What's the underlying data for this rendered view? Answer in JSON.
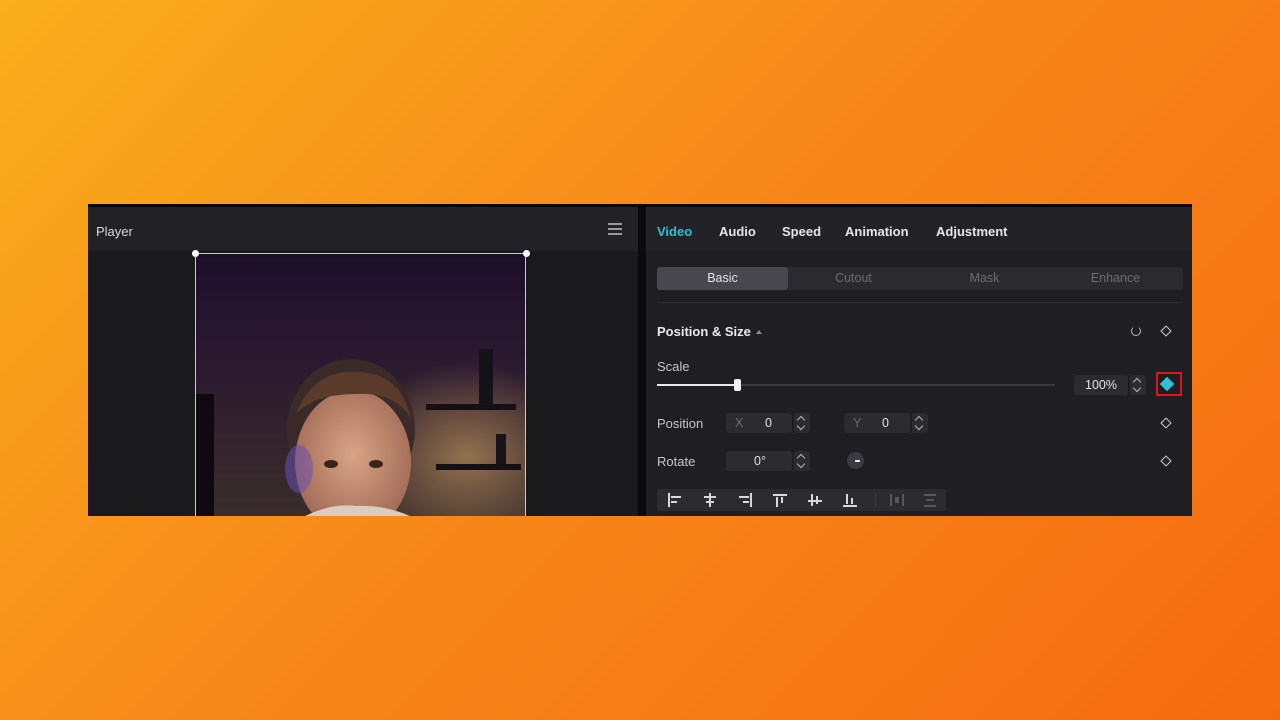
{
  "player": {
    "title": "Player"
  },
  "tabs": [
    {
      "label": "Video",
      "active": true
    },
    {
      "label": "Audio"
    },
    {
      "label": "Speed"
    },
    {
      "label": "Animation"
    },
    {
      "label": "Adjustment"
    }
  ],
  "subtabs": [
    {
      "label": "Basic",
      "active": true
    },
    {
      "label": "Cutout"
    },
    {
      "label": "Mask"
    },
    {
      "label": "Enhance"
    }
  ],
  "section": {
    "title": "Position & Size"
  },
  "scale": {
    "label": "Scale",
    "value": "100%",
    "slider_fraction": 0.2
  },
  "position": {
    "label": "Position",
    "x_prefix": "X",
    "x_value": "0",
    "y_prefix": "Y",
    "y_value": "0"
  },
  "rotate": {
    "label": "Rotate",
    "value": "0°"
  },
  "colors": {
    "accent": "#2fc2d4",
    "highlight": "#e0141e"
  },
  "icons": [
    "menu-icon",
    "reset-icon",
    "keyframe-icon",
    "stepper-icon",
    "rotate-knob-icon",
    "align-left-icon",
    "align-center-h-icon",
    "align-right-icon",
    "align-top-icon",
    "align-center-v-icon",
    "align-bottom-icon",
    "distribute-h-icon",
    "distribute-v-icon"
  ]
}
